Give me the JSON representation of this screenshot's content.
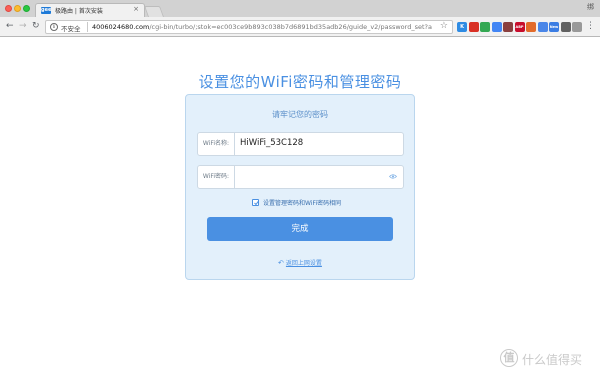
{
  "browser": {
    "tab": {
      "favicon_text": "gee",
      "title": "极路由 | 首次安装",
      "close_glyph": "×"
    },
    "profile_glyph": "绑",
    "security_label": "不安全",
    "url_host": "4006024680.com",
    "url_path": "/cgi-bin/turbo/;stok=ec003ce9b893c038b7d6891bd35adb26/guide_v2/password_set?auto...",
    "extensions": [
      {
        "name": "evernote-extension-icon",
        "color": "#2e8be3",
        "text": "K"
      },
      {
        "name": "adblock-extension-icon",
        "color": "#d93025",
        "text": ""
      },
      {
        "name": "google-extension-icon",
        "color": "#34a853",
        "text": ""
      },
      {
        "name": "drive-extension-icon",
        "color": "#4285f4",
        "text": ""
      },
      {
        "name": "ublock-extension-icon",
        "color": "#8a3f3f",
        "text": ""
      },
      {
        "name": "abp-extension-icon",
        "color": "#c70d2c",
        "text": "ABP"
      },
      {
        "name": "onenote-extension-icon",
        "color": "#e36b2a",
        "text": ""
      },
      {
        "name": "translate-extension-icon",
        "color": "#4a86e8",
        "text": ""
      },
      {
        "name": "new-extension-icon",
        "color": "#3b7de3",
        "text": "New"
      },
      {
        "name": "pocket-extension-icon",
        "color": "#616161",
        "text": ""
      },
      {
        "name": "cast-extension-icon",
        "color": "#999999",
        "text": ""
      }
    ]
  },
  "page": {
    "headline": "设置您的WiFi密码和管理密码",
    "card_subtitle": "请牢记您的密码",
    "wifi_name_label": "WiFi名称:",
    "wifi_name_value": "HiWiFi_53C128",
    "wifi_password_label": "WiFi密码:",
    "wifi_password_value": "",
    "same_password_label": "设置管理密码和WiFi密码相同",
    "same_password_checked": true,
    "done_button": "完成",
    "back_link": "返回上网设置"
  },
  "watermark": {
    "logo_text": "值",
    "text": "什么值得买"
  },
  "colors": {
    "accent": "#4a90e2",
    "card_bg": "#e3f0fb",
    "card_border": "#bad6ee"
  }
}
